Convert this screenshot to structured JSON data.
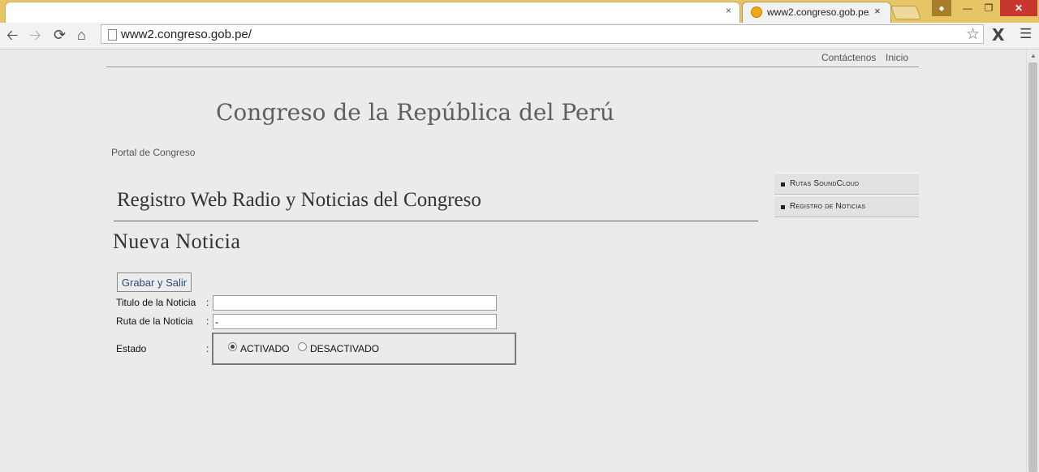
{
  "browser": {
    "tab_title": "www2.congreso.gob.pe/",
    "tab_close": "×",
    "url": "www2.congreso.gob.pe/"
  },
  "topnav": {
    "contact": "Contáctenos",
    "home": "Inicio"
  },
  "site": {
    "title": "Congreso de la República del Perú",
    "breadcrumb": "Portal de Congreso"
  },
  "main": {
    "section_title": "Registro Web Radio y Noticias del Congreso",
    "page_heading": "Nueva Noticia",
    "save_button": "Grabar y Salir"
  },
  "form": {
    "titulo": {
      "label": "Titulo de la Noticia",
      "colon": ":",
      "value": ""
    },
    "ruta": {
      "label": "Ruta de la Noticia",
      "colon": ":",
      "value": "-"
    },
    "estado": {
      "label": "Estado",
      "colon": ":",
      "options": [
        "ACTIVADO",
        "DESACTIVADO"
      ],
      "selected": "ACTIVADO"
    }
  },
  "sidebar": {
    "items": [
      {
        "label": "Rutas SoundCloud"
      },
      {
        "label": "Registro de Noticias"
      }
    ]
  },
  "colors": {
    "tab_strip": "#e7c464",
    "page_background": "#ebebeb",
    "close_button": "#c7372f",
    "button_text": "#2a4d7a"
  }
}
